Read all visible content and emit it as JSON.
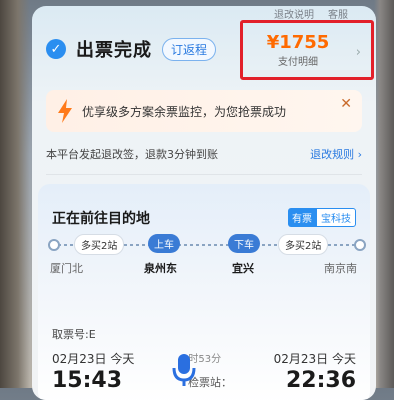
{
  "top_links": [
    "退改说明",
    "客服"
  ],
  "status": {
    "title": "出票完成",
    "return_button": "订返程"
  },
  "price": {
    "amount": "¥1755",
    "label": "支付明细"
  },
  "alert": {
    "text": "优享级多方案余票监控，为您抢票成功"
  },
  "policy": {
    "text": "本平台发起退改签，退款3分钟到账",
    "link": "退改规则"
  },
  "card": {
    "title": "正在前往目的地",
    "brand_a": "有票",
    "brand_b": "宝科技",
    "pills": [
      "多买2站",
      "上车",
      "下车",
      "多买2站"
    ],
    "stations": [
      "厦门北",
      "泉州东",
      "宜兴",
      "南京南"
    ]
  },
  "ticket": {
    "label": "取票号:E",
    "depart_date": "02月23日 今天",
    "arrive_date": "02月23日 今天",
    "depart_time": "15:43",
    "arrive_time": "22:36",
    "duration": "6时53分",
    "checkin": "检票站："
  },
  "icons": [
    "check-icon",
    "bolt-icon",
    "close-icon",
    "chevron-right-icon",
    "mic-icon"
  ]
}
